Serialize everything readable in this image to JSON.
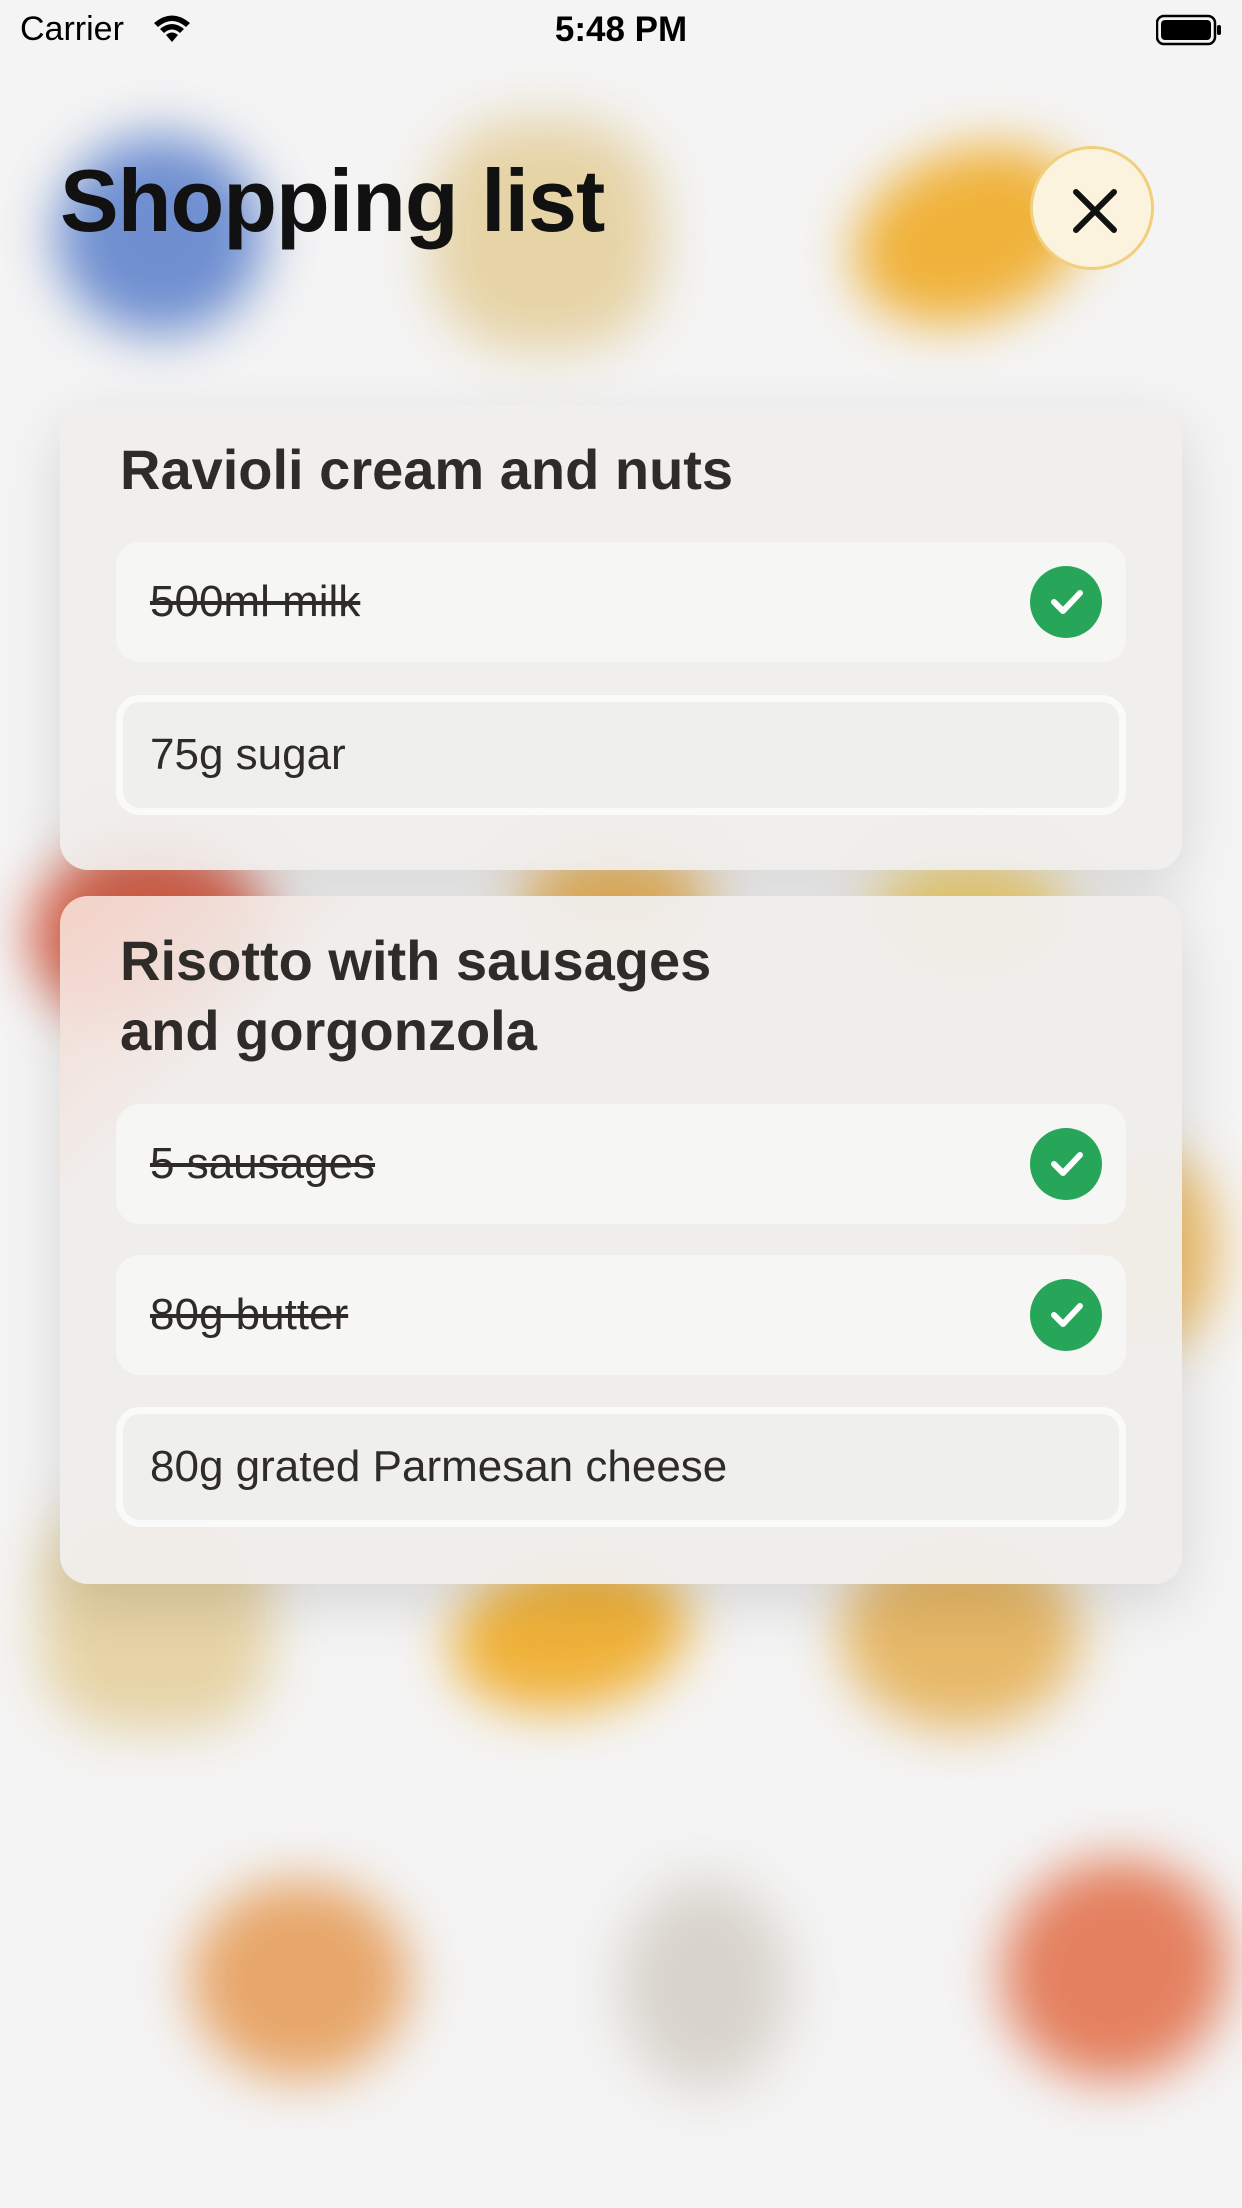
{
  "status_bar": {
    "carrier": "Carrier",
    "time": "5:48 PM"
  },
  "header": {
    "title": "Shopping list",
    "close_icon": "close-icon"
  },
  "colors": {
    "check_green": "#27a65a",
    "close_bg": "#fbf3de",
    "close_border": "#f1cf7b"
  },
  "recipes": [
    {
      "title": "Ravioli cream and nuts",
      "items": [
        {
          "label": "500ml milk",
          "checked": true
        },
        {
          "label": "75g sugar",
          "checked": false
        }
      ]
    },
    {
      "title": "Risotto with sausages and gorgonzola",
      "items": [
        {
          "label": "5 sausages",
          "checked": true
        },
        {
          "label": "80g butter",
          "checked": true
        },
        {
          "label": "80g grated Parmesan cheese",
          "checked": false
        }
      ]
    }
  ]
}
